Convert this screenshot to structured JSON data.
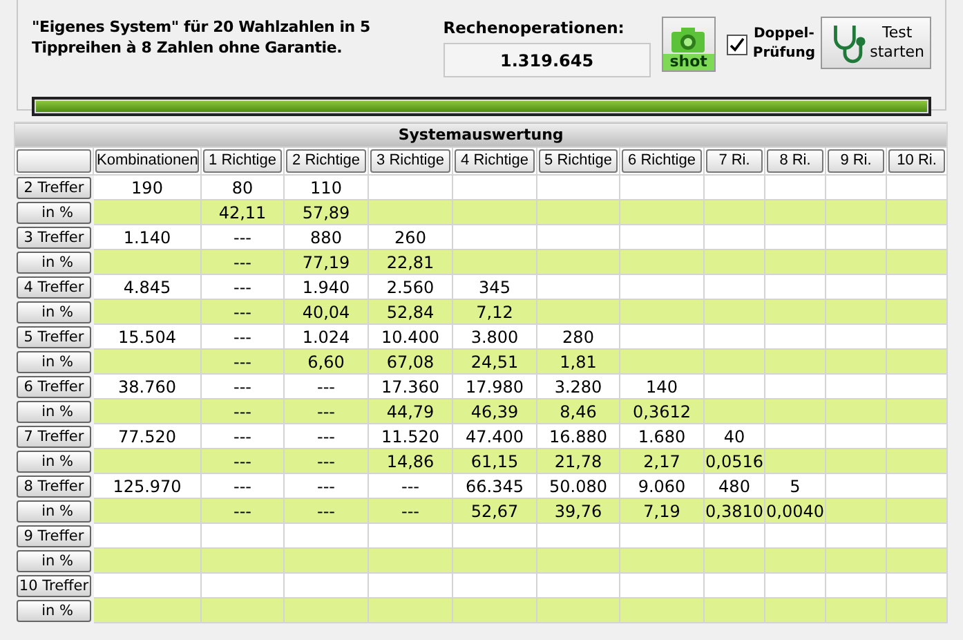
{
  "description": "\"Eigenes System\" für 20 Wahlzahlen in 5 Tippreihen à 8 Zahlen ohne Garantie.",
  "operations": {
    "label": "Rechenoperationen:",
    "value": "1.319.645"
  },
  "shot_button": {
    "label": "shot"
  },
  "double_check": {
    "label": "Doppel-\nPrüfung",
    "checked": true
  },
  "test_button": {
    "label": "Test\nstarten"
  },
  "progress": {
    "level": 1
  },
  "table": {
    "title": "Systemauswertung",
    "columns": [
      "Kombinationen",
      "1 Richtige",
      "2 Richtige",
      "3 Richtige",
      "4 Richtige",
      "5 Richtige",
      "6 Richtige",
      "7 Ri.",
      "8 Ri.",
      "9 Ri.",
      "10 Ri."
    ],
    "rows": [
      {
        "label": "2 Treffer",
        "kind": "count",
        "cells": [
          "190",
          "80",
          "110",
          null,
          null,
          null,
          null,
          null,
          null,
          null,
          null
        ]
      },
      {
        "label": "in %",
        "kind": "percent",
        "cells": [
          null,
          "42,11",
          "57,89",
          null,
          null,
          null,
          null,
          null,
          null,
          null,
          null
        ]
      },
      {
        "label": "3 Treffer",
        "kind": "count",
        "cells": [
          "1.140",
          "---",
          "880",
          "260",
          null,
          null,
          null,
          null,
          null,
          null,
          null
        ]
      },
      {
        "label": "in %",
        "kind": "percent",
        "cells": [
          null,
          "---",
          "77,19",
          "22,81",
          null,
          null,
          null,
          null,
          null,
          null,
          null
        ]
      },
      {
        "label": "4 Treffer",
        "kind": "count",
        "cells": [
          "4.845",
          "---",
          "1.940",
          "2.560",
          "345",
          null,
          null,
          null,
          null,
          null,
          null
        ]
      },
      {
        "label": "in %",
        "kind": "percent",
        "cells": [
          null,
          "---",
          "40,04",
          "52,84",
          "7,12",
          null,
          null,
          null,
          null,
          null,
          null
        ]
      },
      {
        "label": "5 Treffer",
        "kind": "count",
        "cells": [
          "15.504",
          "---",
          "1.024",
          "10.400",
          "3.800",
          "280",
          null,
          null,
          null,
          null,
          null
        ]
      },
      {
        "label": "in %",
        "kind": "percent",
        "cells": [
          null,
          "---",
          "6,60",
          "67,08",
          "24,51",
          "1,81",
          null,
          null,
          null,
          null,
          null
        ]
      },
      {
        "label": "6 Treffer",
        "kind": "count",
        "cells": [
          "38.760",
          "---",
          "---",
          "17.360",
          "17.980",
          "3.280",
          "140",
          null,
          null,
          null,
          null
        ]
      },
      {
        "label": "in %",
        "kind": "percent",
        "cells": [
          null,
          "---",
          "---",
          "44,79",
          "46,39",
          "8,46",
          "0,3612",
          null,
          null,
          null,
          null
        ]
      },
      {
        "label": "7 Treffer",
        "kind": "count",
        "cells": [
          "77.520",
          "---",
          "---",
          "11.520",
          "47.400",
          "16.880",
          "1.680",
          "40",
          null,
          null,
          null
        ]
      },
      {
        "label": "in %",
        "kind": "percent",
        "cells": [
          null,
          "---",
          "---",
          "14,86",
          "61,15",
          "21,78",
          "2,17",
          "0,0516",
          null,
          null,
          null
        ]
      },
      {
        "label": "8 Treffer",
        "kind": "count",
        "cells": [
          "125.970",
          "---",
          "---",
          "---",
          "66.345",
          "50.080",
          "9.060",
          "480",
          "5",
          null,
          null
        ]
      },
      {
        "label": "in %",
        "kind": "percent",
        "cells": [
          null,
          "---",
          "---",
          "---",
          "52,67",
          "39,76",
          "7,19",
          "0,3810",
          "0,0040",
          null,
          null
        ]
      },
      {
        "label": "9 Treffer",
        "kind": "count",
        "cells": [
          null,
          null,
          null,
          null,
          null,
          null,
          null,
          null,
          null,
          null,
          null
        ]
      },
      {
        "label": "in %",
        "kind": "percent",
        "cells": [
          null,
          null,
          null,
          null,
          null,
          null,
          null,
          null,
          null,
          null,
          null
        ]
      },
      {
        "label": "10 Treffer",
        "kind": "count",
        "cells": [
          null,
          null,
          null,
          null,
          null,
          null,
          null,
          null,
          null,
          null,
          null
        ]
      },
      {
        "label": "in %",
        "kind": "percent",
        "cells": [
          null,
          null,
          null,
          null,
          null,
          null,
          null,
          null,
          null,
          null,
          null
        ]
      }
    ]
  }
}
